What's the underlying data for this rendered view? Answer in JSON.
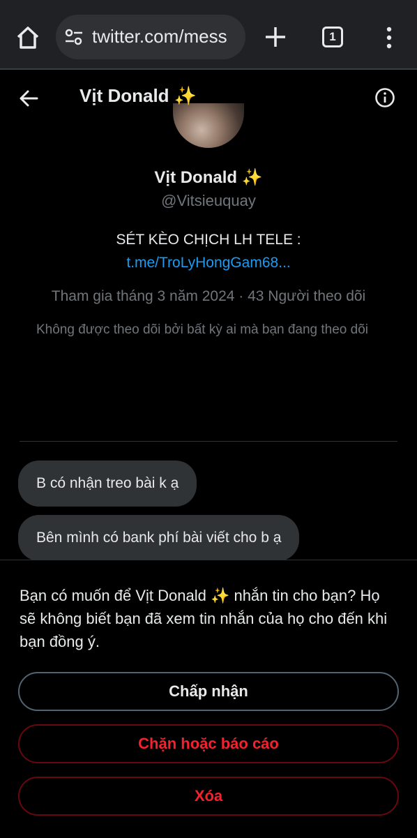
{
  "browser": {
    "url": "twitter.com/mess",
    "tab_count": "1",
    "icons": [
      "home-icon",
      "site-settings-icon",
      "new-tab-icon",
      "tab-switcher-icon",
      "more-options-icon"
    ]
  },
  "header": {
    "title": "Vịt Donald ✨"
  },
  "profile": {
    "name": "Vịt Donald ✨",
    "handle": "@Vitsieuquay",
    "bio_line": "SÉT KÈO CHỊCH LH TELE :",
    "bio_link": "t.me/TroLyHongGam68...",
    "joined": "Tham gia tháng 3 năm 2024 · 43 Người theo dõi",
    "followers_note": "Không được theo dõi bởi bất kỳ ai mà bạn đang theo dõi"
  },
  "messages": [
    {
      "text": "B có nhận treo bài k ạ"
    },
    {
      "text": "Bên mình có bank phí bài viết cho b ạ"
    }
  ],
  "request": {
    "prompt": "Bạn có muốn để Vịt Donald ✨ nhắn tin cho bạn? Họ sẽ không biết bạn đã xem tin nhắn của họ cho đến khi bạn đồng ý.",
    "accept_label": "Chấp nhận",
    "block_label": "Chặn hoặc báo cáo",
    "delete_label": "Xóa"
  },
  "colors": {
    "background": "#000000",
    "link": "#1d9bf0",
    "danger": "#f4212e",
    "muted": "#71767b",
    "bubble": "#2f3336"
  }
}
